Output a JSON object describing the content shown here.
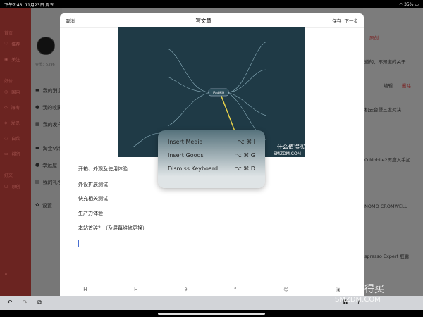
{
  "status": {
    "time": "下午7:43",
    "date": "11月23日 周五",
    "battery": "35%"
  },
  "nav": {
    "sections": [
      "首页",
      "好价",
      "好文"
    ],
    "items": [
      "推荐",
      "关注",
      "国内",
      "海淘",
      "发现",
      "白菜",
      "排行",
      "原创"
    ]
  },
  "profile": {
    "coins": "金币：5396",
    "items": [
      "我的消息",
      "我的收藏",
      "我的发布",
      "淘金V计划",
      "幸运屋",
      "我的礼包",
      "设置"
    ]
  },
  "right": {
    "tab": "原创",
    "snippets": [
      "道的，不知道的关于",
      "机云台暨三度对决",
      "O Mobile2再度入手加",
      "NOMO CROMWELL",
      "spresso Expert 胶囊"
    ],
    "edit": "编辑",
    "delete": "删除"
  },
  "sheet": {
    "cancel": "取消",
    "title": "写文章",
    "save": "保存",
    "next": "下一步",
    "image_caption": "什么值得买",
    "image_site": "SMZDM.COM",
    "mind_center": "iPad评测",
    "paragraphs": [
      "开箱、外观及使用体验",
      "外设扩展测试",
      "快充相关测试",
      "生产力体验",
      "本站首碎？（及屏幕维修更换）"
    ]
  },
  "popup": {
    "items": [
      {
        "label": "Insert Media",
        "shortcut": "⌥ ⌘ I"
      },
      {
        "label": "Insert Goods",
        "shortcut": "⌥ ⌘ G"
      },
      {
        "label": "Dismiss Keyboard",
        "shortcut": "⌥ ⌘ D"
      }
    ]
  },
  "keyboard": {
    "undo": "↶",
    "redo": "↷",
    "paste": "⧉",
    "bold": "B",
    "italic": "I"
  },
  "watermark": {
    "name": "什么值得买",
    "site": "SMZDM.COM"
  }
}
